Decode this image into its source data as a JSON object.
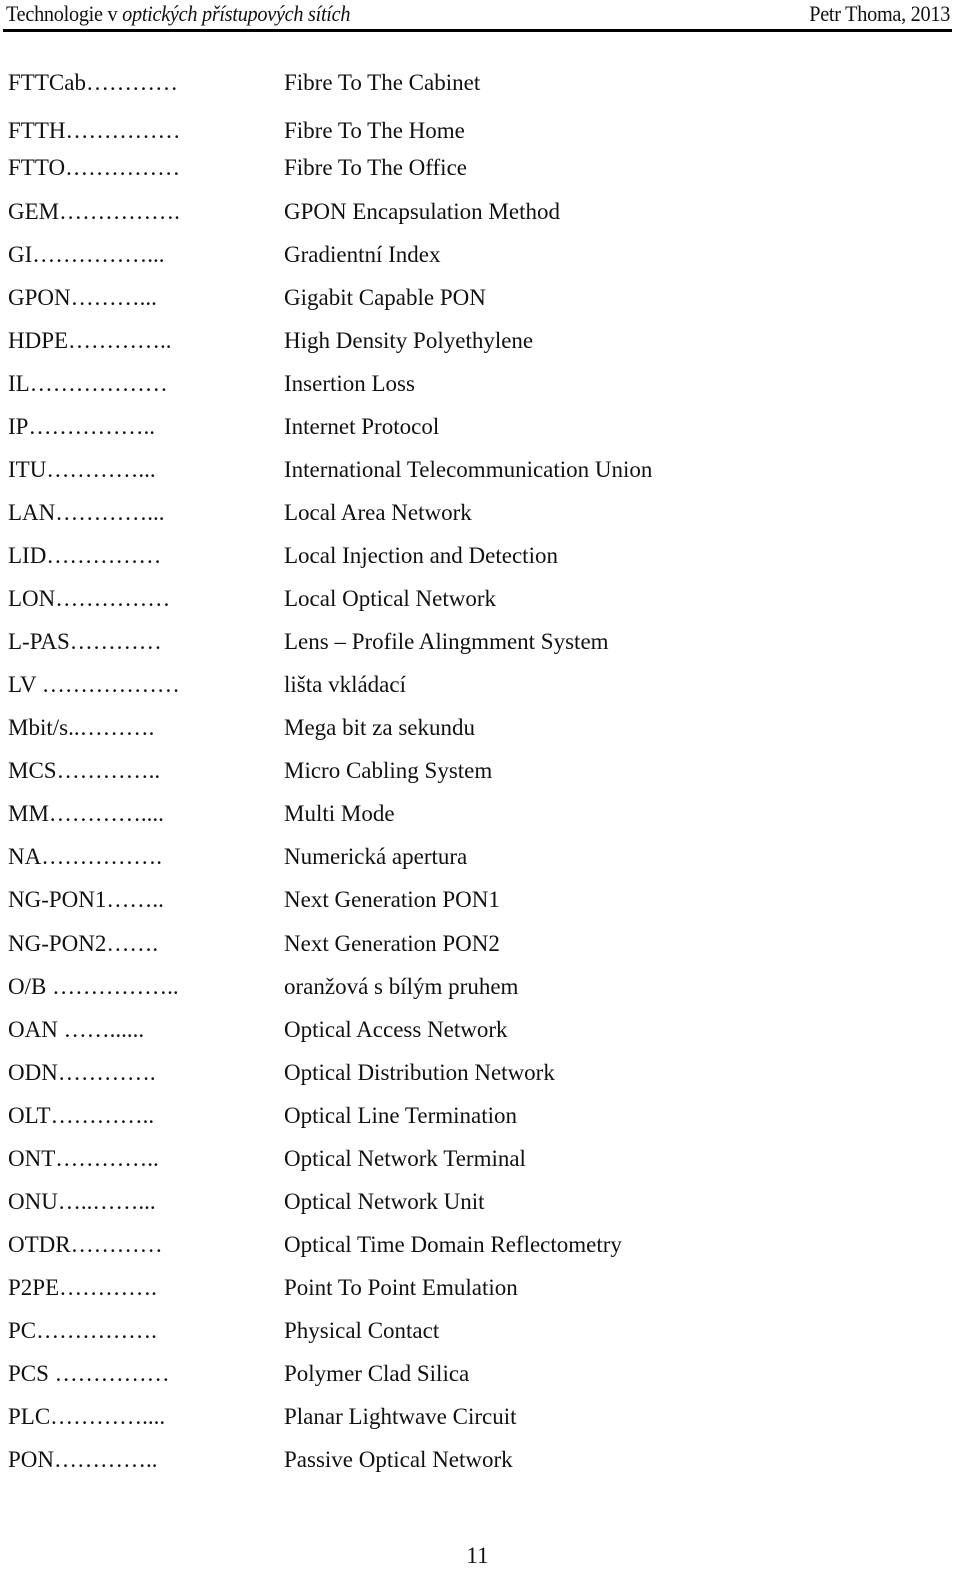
{
  "header": {
    "title_prefix": "Technologie v ",
    "title_italic": "optických přístupových sítích",
    "author_year": "Petr Thoma, 2013"
  },
  "abbreviations": [
    {
      "abbr": "FTTCab…………",
      "meaning": "Fibre To The Cabinet"
    },
    {
      "abbr": "FTTH……………",
      "meaning": "Fibre To The Home"
    },
    {
      "abbr": "FTTO……………",
      "meaning": "Fibre To The Office"
    },
    {
      "abbr": "GEM…………….",
      "meaning": "GPON Encapsulation Method"
    },
    {
      "abbr": "GI……………...",
      "meaning": "Gradientní Index"
    },
    {
      "abbr": "GPON………...",
      "meaning": "Gigabit Capable PON"
    },
    {
      "abbr": "HDPE…………..",
      "meaning": "High Density Polyethylene"
    },
    {
      "abbr": "IL………………",
      "meaning": "Insertion Loss"
    },
    {
      "abbr": "IP……………..",
      "meaning": "Internet Protocol"
    },
    {
      "abbr": "ITU…………...",
      "meaning": "International Telecommunication Union"
    },
    {
      "abbr": "LAN…………...",
      "meaning": "Local Area Network"
    },
    {
      "abbr": "LID……………",
      "meaning": "Local Injection and Detection"
    },
    {
      "abbr": "LON……………",
      "meaning": "Local Optical Network"
    },
    {
      "abbr": "L-PAS…………",
      "meaning": "Lens – Profile Alingmment System"
    },
    {
      "abbr": "LV ………………",
      "meaning": "lišta vkládací"
    },
    {
      "abbr": "Mbit/s..……….",
      "meaning": "Mega bit za sekundu"
    },
    {
      "abbr": "MCS…………..",
      "meaning": "Micro Cabling System"
    },
    {
      "abbr": "MM…………....",
      "meaning": "Multi Mode"
    },
    {
      "abbr": "NA…………….",
      "meaning": "Numerická apertura"
    },
    {
      "abbr": "NG-PON1……..",
      "meaning": "Next Generation PON1"
    },
    {
      "abbr": "NG-PON2…….",
      "meaning": "Next Generation PON2"
    },
    {
      "abbr": "O/B ……………..",
      "meaning": "oranžová s bílým pruhem"
    },
    {
      "abbr": "OAN ……......",
      "meaning": "Optical Access Network"
    },
    {
      "abbr": "ODN………….",
      "meaning": "Optical Distribution Network"
    },
    {
      "abbr": "OLT…………..",
      "meaning": "Optical Line Termination"
    },
    {
      "abbr": "ONT…………..",
      "meaning": "Optical Network Terminal"
    },
    {
      "abbr": "ONU…..……...",
      "meaning": "Optical Network Unit"
    },
    {
      "abbr": "OTDR…………",
      "meaning": "Optical Time Domain Reflectometry"
    },
    {
      "abbr": "P2PE………….",
      "meaning": "Point To Point Emulation"
    },
    {
      "abbr": "PC…………….",
      "meaning": "Physical Contact"
    },
    {
      "abbr": "PCS ……………",
      "meaning": "Polymer Clad Silica"
    },
    {
      "abbr": "PLC…………....",
      "meaning": "Planar Lightwave Circuit"
    },
    {
      "abbr": "PON…………..",
      "meaning": "Passive Optical Network"
    }
  ],
  "footer": {
    "page_number": "11"
  }
}
